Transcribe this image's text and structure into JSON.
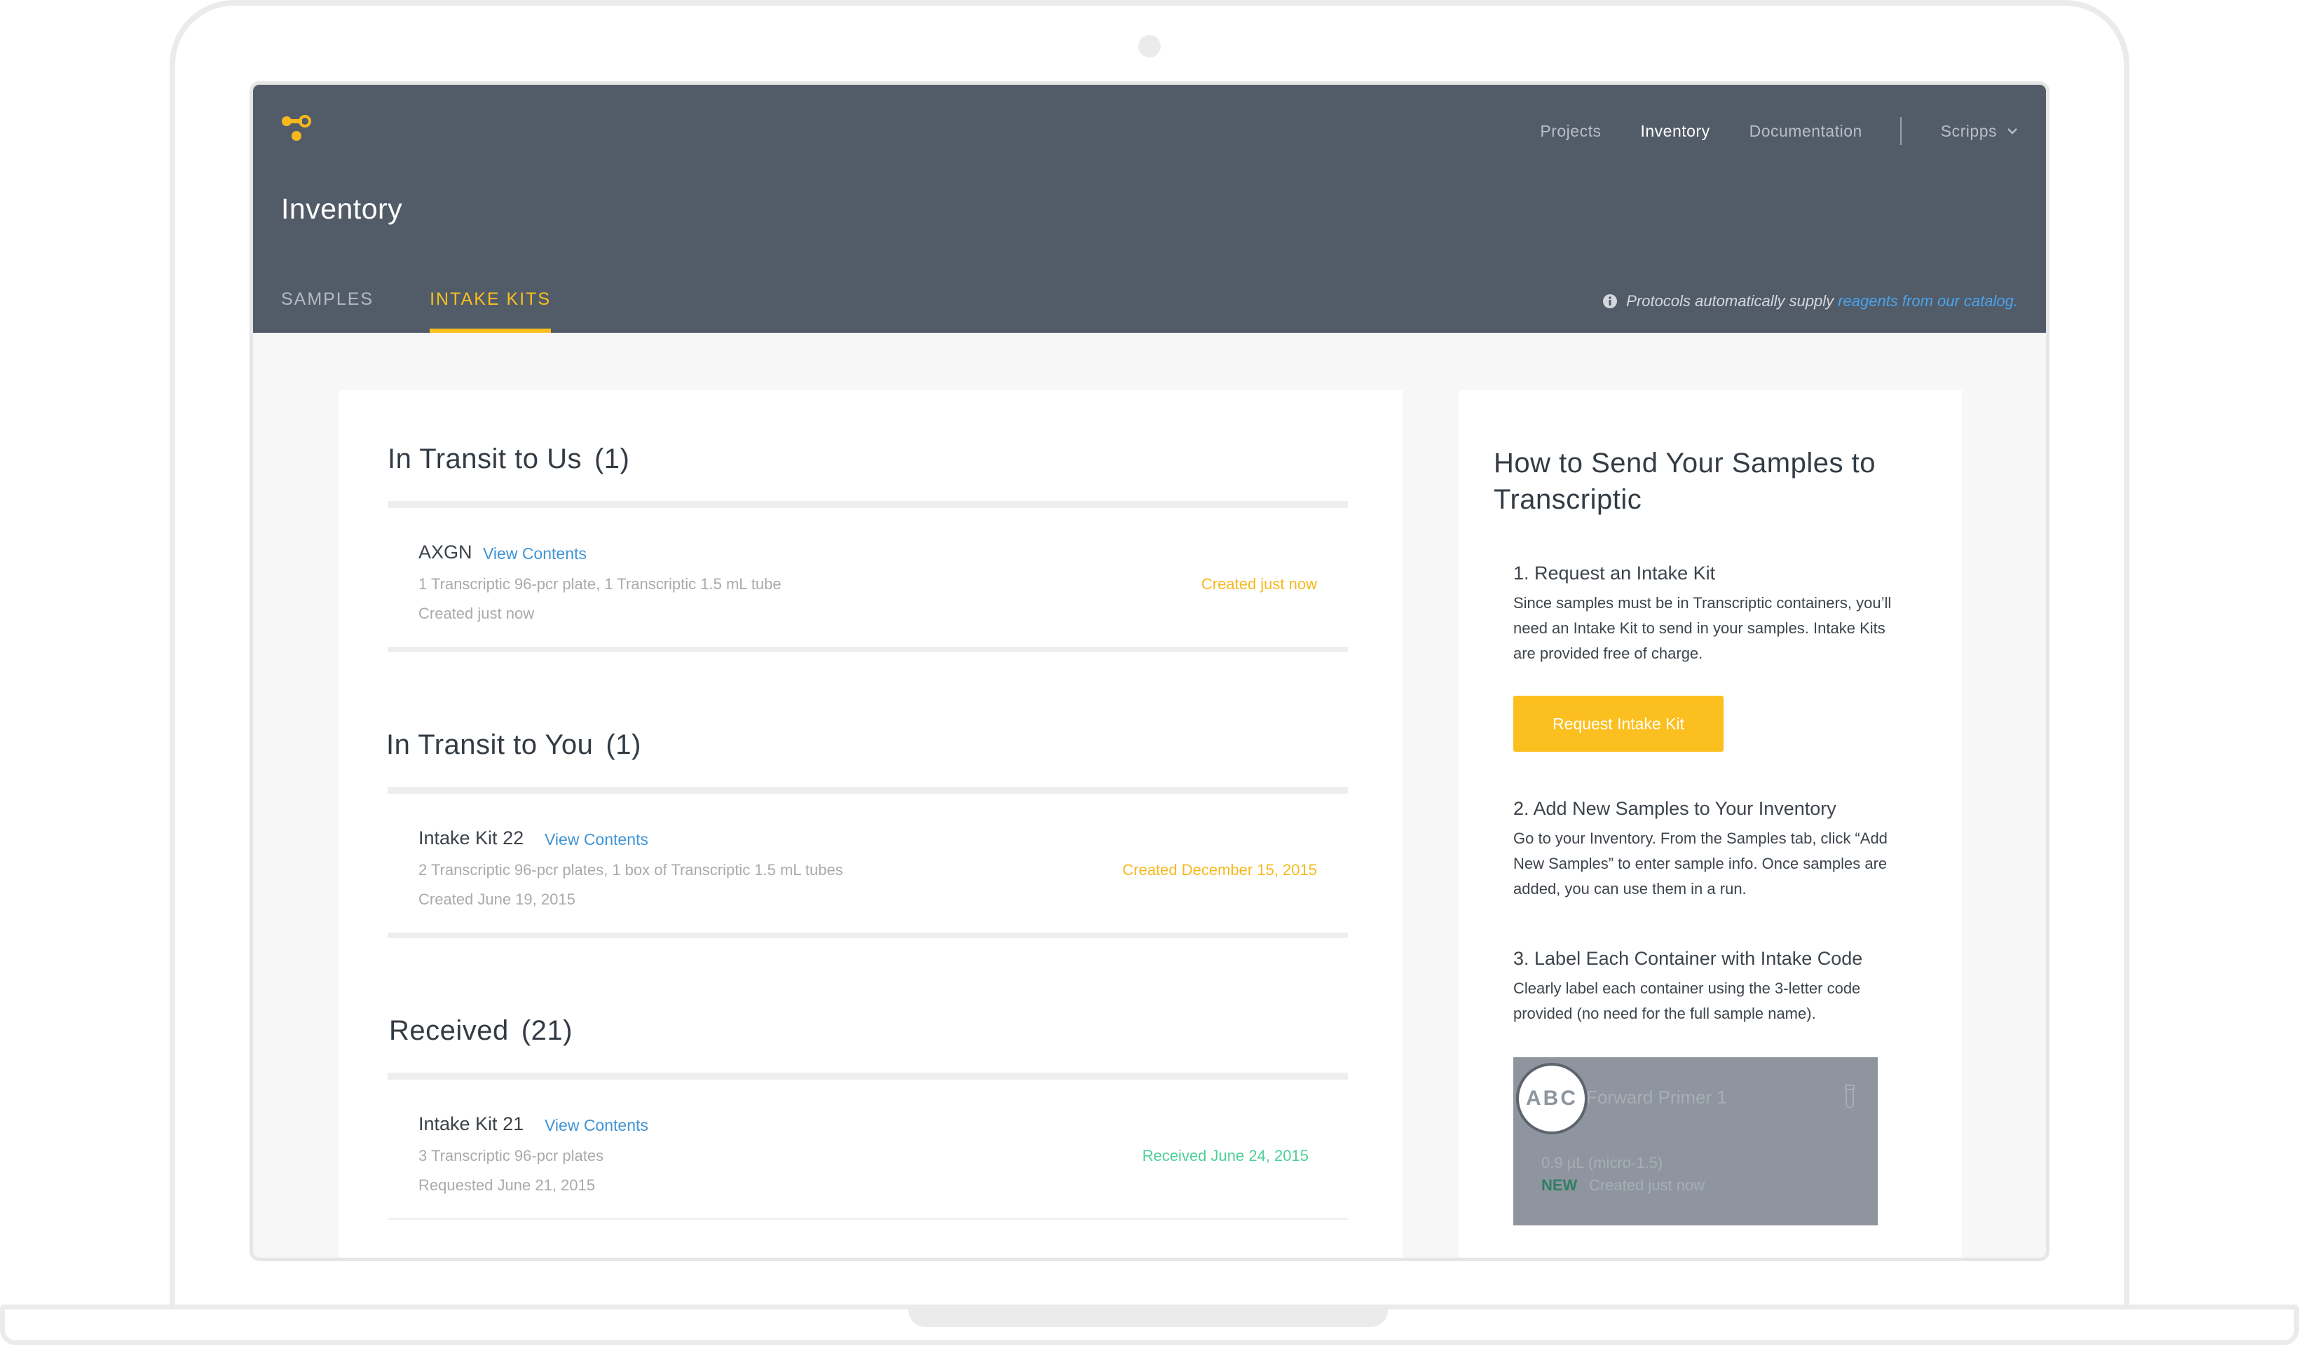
{
  "header": {
    "nav": {
      "projects": "Projects",
      "inventory": "Inventory",
      "documentation": "Documentation",
      "org": "Scripps"
    },
    "page_title": "Inventory",
    "tabs": {
      "samples": "SAMPLES",
      "intake_kits": "INTAKE KITS"
    },
    "protocol_note": {
      "text": "Protocols automatically supply",
      "link": "reagents from our catalog."
    }
  },
  "sections": {
    "to_us": {
      "title": "In Transit to Us",
      "count": "(1)",
      "items": [
        {
          "name": "AXGN",
          "link": "View Contents",
          "description": "1 Transcriptic 96-pcr plate, 1 Transcriptic 1.5 mL tube",
          "date": "Created just now",
          "status": "Created just now"
        }
      ]
    },
    "to_you": {
      "title": "In Transit to You",
      "count": "(1)",
      "items": [
        {
          "name": "Intake Kit 22",
          "link": "View Contents",
          "description": "2 Transcriptic 96-pcr plates, 1 box of Transcriptic 1.5 mL tubes",
          "date": "Created June 19, 2015",
          "status": "Created December 15, 2015"
        }
      ]
    },
    "received": {
      "title": "Received",
      "count": "(21)",
      "items": [
        {
          "name": "Intake Kit 21",
          "link": "View Contents",
          "description": "3 Transcriptic 96-pcr plates",
          "date": "Requested June 21, 2015",
          "status": "Received June 24, 2015"
        }
      ]
    }
  },
  "sidebar": {
    "title": "How to Send Your Samples to Transcriptic",
    "steps": [
      {
        "title": "1. Request an Intake Kit",
        "text": "Since samples must be in Transcriptic containers, you’ll need an Intake Kit to send in your samples. Intake Kits are provided free of charge."
      },
      {
        "title": "2. Add New Samples to Your Inventory",
        "text": "Go to your Inventory. From the Samples tab, click “Add New Samples” to enter sample info. Once samples are added, you can use them in a run."
      },
      {
        "title": "3.  Label Each Container with Intake Code",
        "text": "Clearly label each container using the 3-letter code provided (no need for the full sample name)."
      }
    ],
    "request_button": "Request Intake Kit",
    "example": {
      "code": "ABC",
      "name": "Forward Primer 1",
      "volume": "0.9 µL (micro-1.5)",
      "badge": "NEW",
      "created": "Created just now"
    }
  },
  "colors": {
    "header_bg": "#525c68",
    "accent_yellow": "#fbbf1f",
    "link_blue": "#3f94d6",
    "status_green": "#4fcf9a"
  }
}
